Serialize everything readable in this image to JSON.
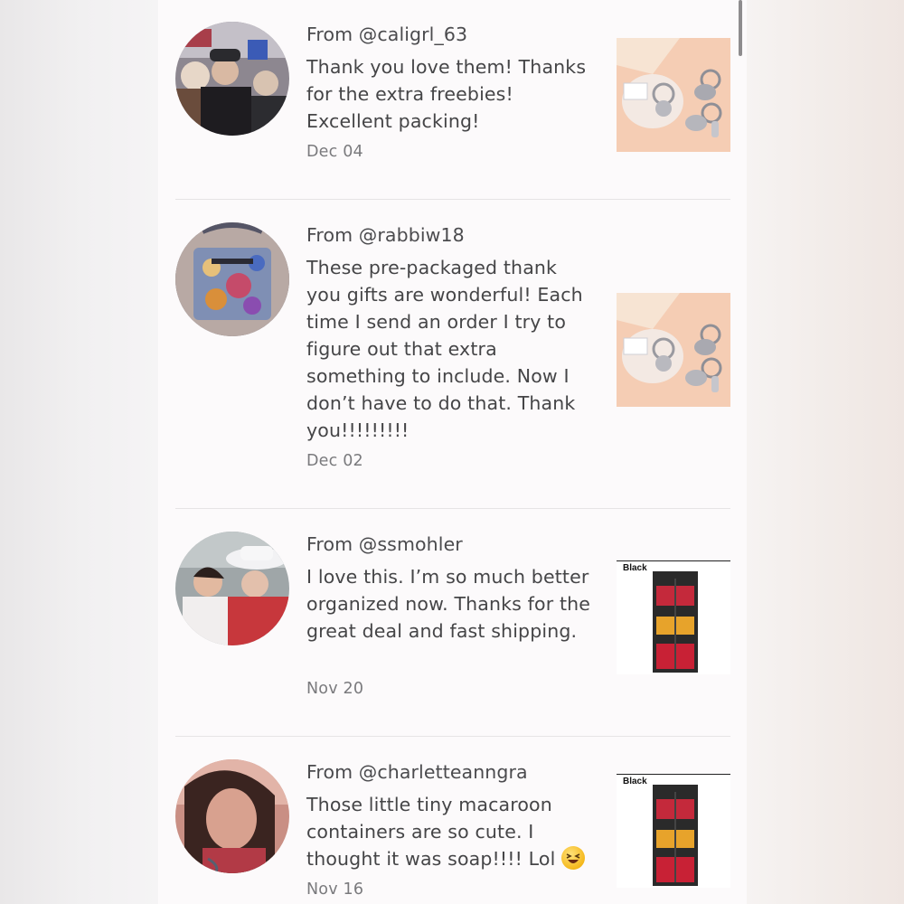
{
  "reviews": [
    {
      "from": "From @caligrl_63",
      "text": "Thank you love them! Thanks for the extra freebies! Excellent packing!",
      "date": "Dec 04",
      "thumb": "keychain"
    },
    {
      "from": "From @rabbiw18",
      "text": "These pre-packaged thank you gifts are wonderful! Each time I send an order I try to figure out that extra something to include. Now I don’t have to do that. Thank you!!!!!!!!!",
      "date": "Dec 02",
      "thumb": "keychain"
    },
    {
      "from": "From @ssmohler",
      "text": "I love this. I’m so much better organized now. Thanks for the great deal and fast shipping.",
      "date": "Nov 20",
      "thumb": "organizer",
      "thumb_label": "Black"
    },
    {
      "from": "From @charletteanngra",
      "text": "Those little tiny macaroon containers are so cute. I thought it was soap!!!! Lol",
      "date": "Nov 16",
      "thumb": "organizer",
      "thumb_label": "Black",
      "emoji": "laughing-squint-emoji"
    }
  ],
  "colors": {
    "panel_bg": "#fcfafb",
    "text": "#454547",
    "date": "#7a7a7d",
    "divider": "#e6e4e5"
  }
}
